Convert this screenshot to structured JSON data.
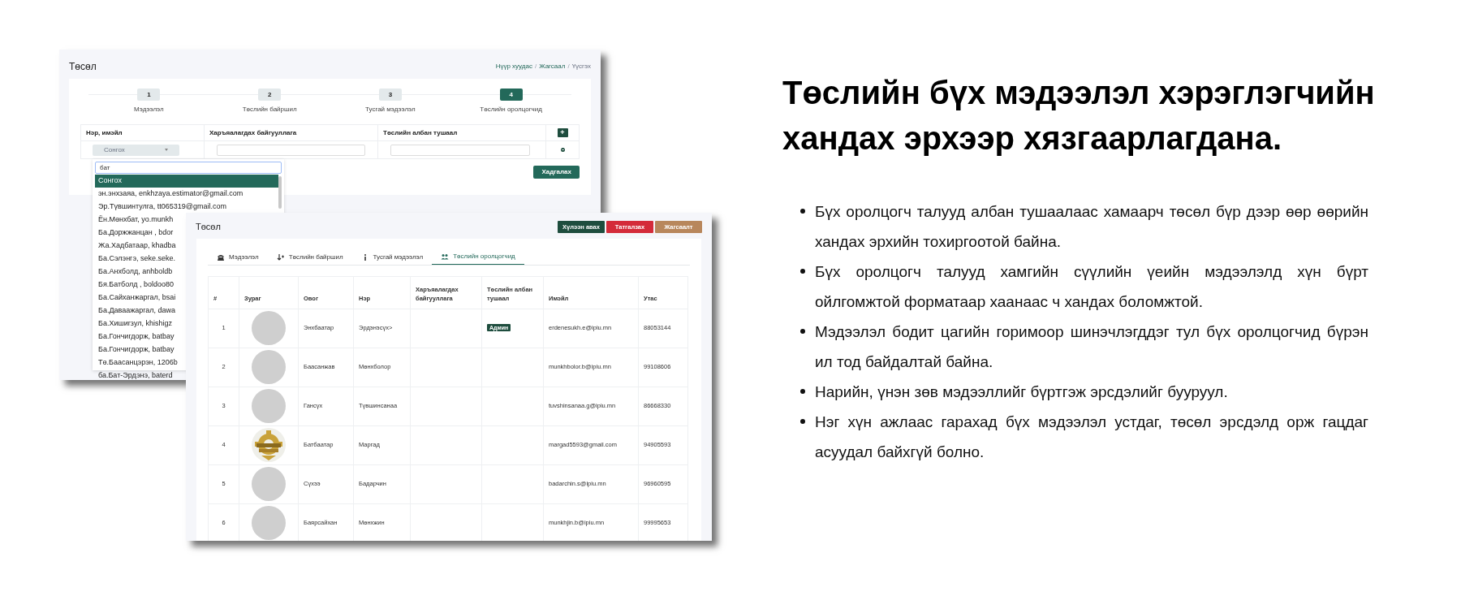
{
  "form_window": {
    "title": "Төсөл",
    "breadcrumb": [
      {
        "label": "Нүүр хуудас",
        "kind": "link"
      },
      {
        "label": "/",
        "kind": "separator"
      },
      {
        "label": "Жагсаал",
        "kind": "link"
      },
      {
        "label": "/",
        "kind": "separator"
      },
      {
        "label": "Үүсгэх",
        "kind": "current"
      }
    ],
    "steps": [
      {
        "number": "1",
        "label": "Мэдээлэл",
        "selected": false
      },
      {
        "number": "2",
        "label": "Төслийн байршил",
        "selected": false
      },
      {
        "number": "3",
        "label": "Тусгай мэдээлэл",
        "selected": false
      },
      {
        "number": "4",
        "label": "Төслийн оролцогчид",
        "selected": true
      }
    ],
    "table": {
      "columns": [
        "Нэр, имэйл",
        "Харъяалагдах байгууллага",
        "Төслийн албан тушаал"
      ],
      "add_button": "+",
      "select_value": "Сонгох"
    },
    "dropdown": {
      "search_value": "бат",
      "options": [
        {
          "label": "Сонгох",
          "selected": true
        },
        {
          "label": "эн.энхзаяа, enkhzaya.estimator@gmail.com",
          "selected": false
        },
        {
          "label": "Эр.Түвшинтулга, tt065319@gmail.com",
          "selected": false
        },
        {
          "label": "Ён.Мөнхбат, yo.munkh",
          "selected": false
        },
        {
          "label": "Ба.Доржжанцан , bdor",
          "selected": false
        },
        {
          "label": "Жа.Хадбатаар, khadba",
          "selected": false
        },
        {
          "label": "Ба.Сэлэнгэ, seke.seke.",
          "selected": false
        },
        {
          "label": "Ба.Анхболд, anhboldb",
          "selected": false
        },
        {
          "label": "Бя.Батболд , boldoo80",
          "selected": false
        },
        {
          "label": "Ба.Сайханжаргал, bsai",
          "selected": false
        },
        {
          "label": "Ба.Даваажаргал, dawa",
          "selected": false
        },
        {
          "label": "Ба.Хишигзул, khishigz",
          "selected": false
        },
        {
          "label": "Ба.Гончигдорж, batbay",
          "selected": false
        },
        {
          "label": "Ба.Гончигдорж, batbay",
          "selected": false
        },
        {
          "label": "Тө.Баасанцэрэн, 1206b",
          "selected": false
        },
        {
          "label": "ба.Бат-Эрдэнэ, baterd",
          "selected": false
        }
      ]
    },
    "save_button": "Хадгалах"
  },
  "participants_window": {
    "title": "Төсөл",
    "buttons": [
      {
        "label": "Хүлээн авах",
        "kind": "accept"
      },
      {
        "label": "Татгалзах",
        "kind": "reject"
      },
      {
        "label": "Жагсаалт",
        "kind": "list"
      }
    ],
    "tabs": [
      {
        "label": "Мэдээлэл",
        "selected": false
      },
      {
        "label": "Төслийн байршил",
        "selected": false
      },
      {
        "label": "Тусгай мэдээлэл",
        "selected": false
      },
      {
        "label": "Төслийн оролцогчид",
        "selected": true
      }
    ],
    "table": {
      "columns": [
        "#",
        "Зураг",
        "Овог",
        "Нэр",
        "Харъяалагдах байгууллага",
        "Төслийн албан тушаал",
        "Имэйл",
        "Утас"
      ],
      "rows": [
        {
          "number": "1",
          "avatar": {
            "kind": "placeholder"
          },
          "last_name": "Энхбаатар",
          "first_name": "Эрдэнэсүх>",
          "role": "Админ",
          "email": "erdenesukh.e@ipiu.mn",
          "phone": "88053144"
        },
        {
          "number": "2",
          "avatar": {
            "kind": "placeholder"
          },
          "last_name": "Баасанжав",
          "first_name": "Мөнхболор",
          "email": "munkhbolor.b@ipiu.mn",
          "phone": "99108606"
        },
        {
          "number": "3",
          "avatar": {
            "kind": "placeholder"
          },
          "last_name": "Гансүх",
          "first_name": "Түвшинсанаа",
          "email": "tuvshinsanaa.g@ipiu.mn",
          "phone": "86668330"
        },
        {
          "number": "4",
          "last_name": "Батбаатар",
          "first_name": "Маргад",
          "email": "margad5593@gmail.com",
          "phone": "94905593"
        },
        {
          "number": "5",
          "avatar": {
            "kind": "placeholder"
          },
          "last_name": "Сүхээ",
          "first_name": "Бадарчин",
          "email": "badarchin.s@ipiu.mn",
          "phone": "96960595"
        },
        {
          "number": "6",
          "avatar": {
            "kind": "placeholder"
          },
          "last_name": "Баярсайхан",
          "first_name": "Мөнхжин",
          "email": "munkhjin.b@ipiu.mn",
          "phone": "99995653"
        }
      ]
    }
  },
  "description": {
    "title": "Төслийн бүх мэдээлэл хэрэглэгчийн хандах эрхээр хязгаарлагдана.",
    "bullets": [
      "Бүх оролцогч талууд албан тушаалаас хамаарч төсөл бүр дээр өөр өөрийн хандах эрхийн тохиргоотой байна.",
      "Бүх оролцогч талууд хамгийн сүүлийн үеийн мэдээлэлд хүн бүрт ойлгомжтой форматаар хаанаас ч хандах боломжтой.",
      "Мэдээлэл бодит цагийн горимоор шинэчлэгддэг тул бүх оролцогчид бүрэн ил тод байдалтай байна.",
      "Нарийн, үнэн зөв мэдээллийг бүртгэж эрсдэлийг бууруул.",
      "Нэг хүн ажлаас гарахад бүх мэдээлэл устдаг, төсөл эрсдэлд орж гацдаг асуудал байхгүй болно."
    ]
  }
}
